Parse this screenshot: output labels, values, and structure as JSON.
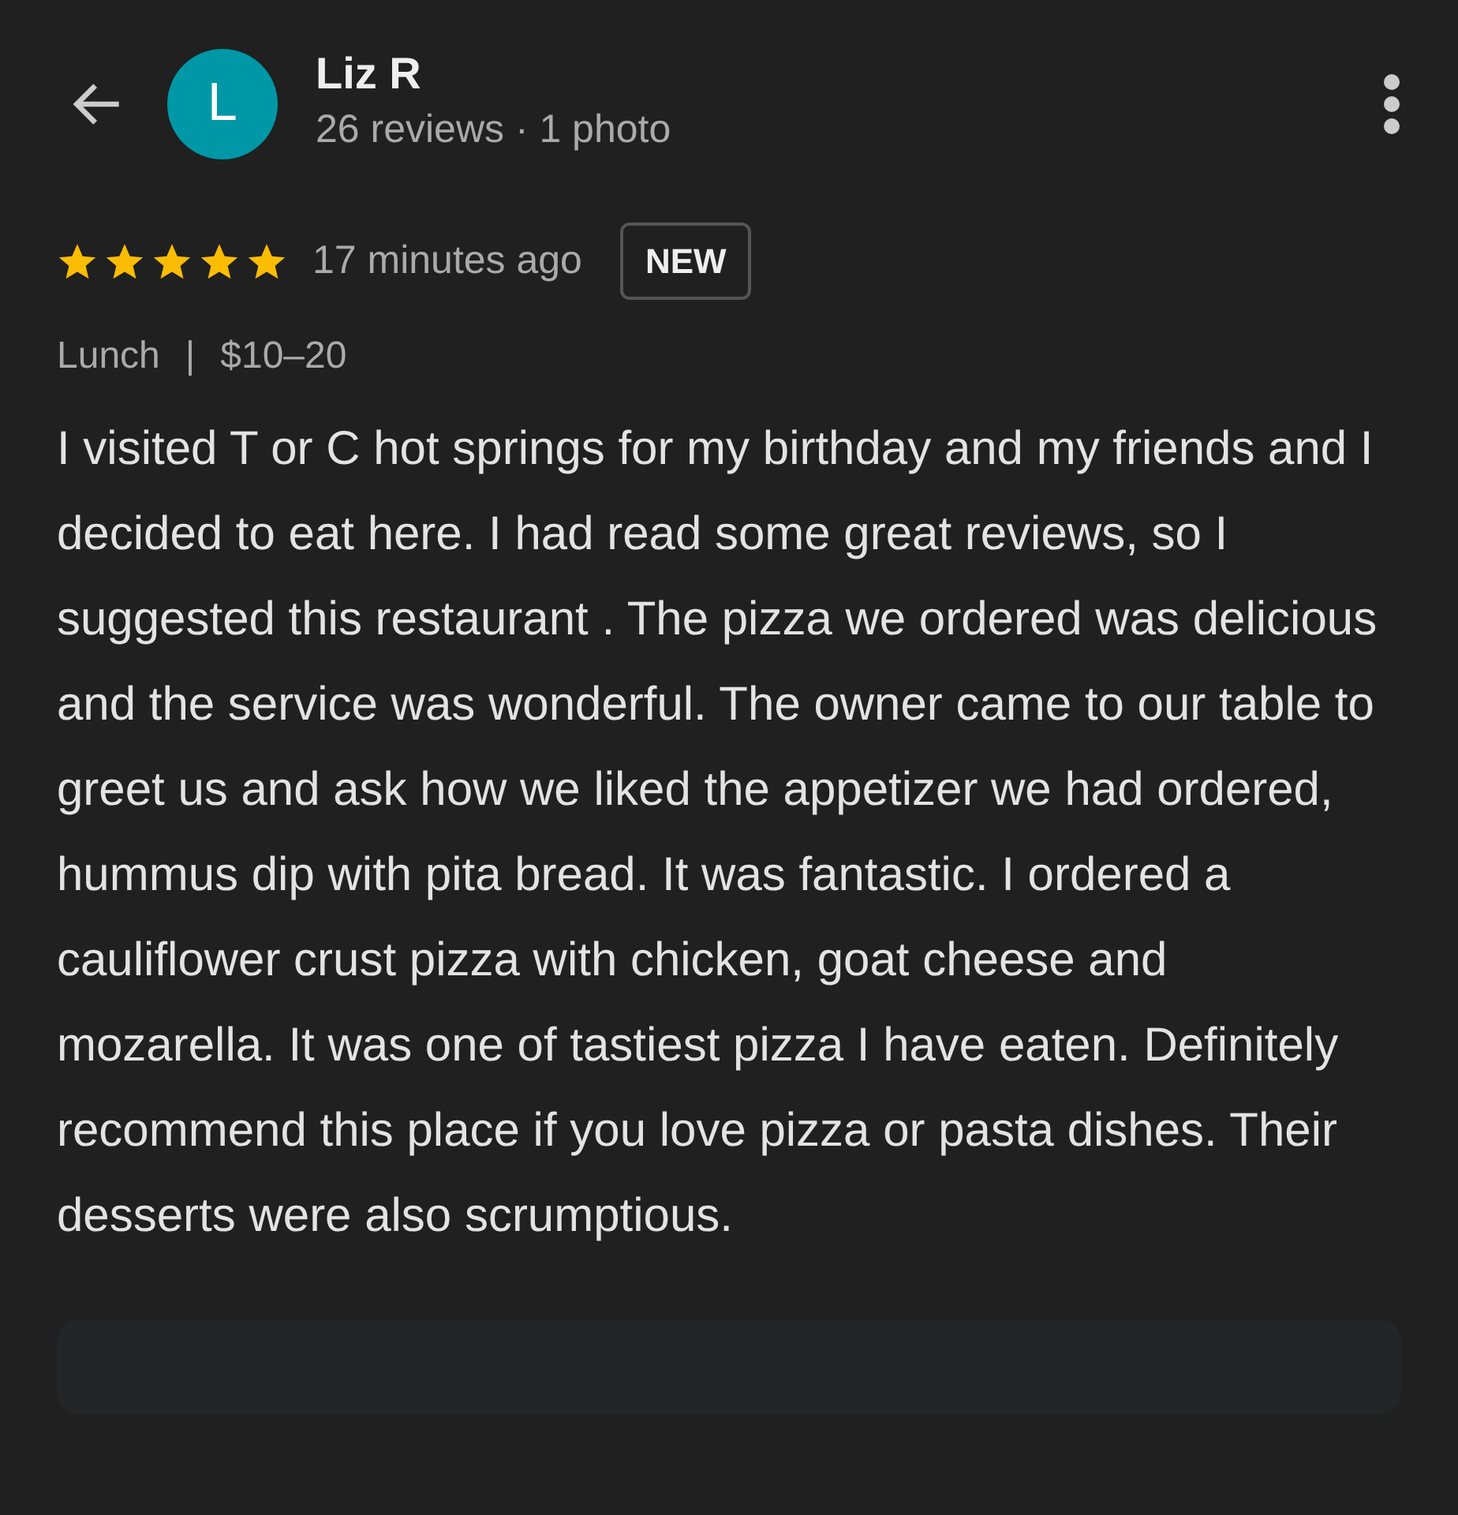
{
  "reviewer": {
    "initial": "L",
    "name": "Liz R",
    "stats": "26 reviews · 1 photo"
  },
  "review": {
    "stars": 5,
    "time": "17 minutes ago",
    "badge": "NEW",
    "tags": [
      "Lunch",
      "$10–20"
    ],
    "separator": "|",
    "text": "I visited T or C hot springs for my birthday and my friends and I decided to eat here. I had read some great reviews, so I suggested this restaurant . The pizza we ordered was delicious and the service was wonderful. The owner came to our table to greet us and ask how we liked the appetizer we had ordered, hummus dip with pita bread. It was fantastic. I ordered a cauliflower crust pizza with chicken, goat cheese and mozarella. It was one of tastiest pizza I have eaten. Definitely recommend this place if you love pizza or pasta dishes. Their desserts were also scrumptious."
  }
}
